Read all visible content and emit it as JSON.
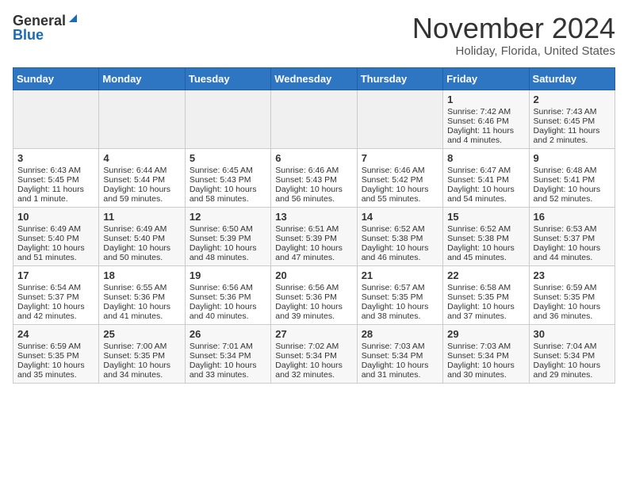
{
  "header": {
    "logo_general": "General",
    "logo_blue": "Blue",
    "month": "November 2024",
    "location": "Holiday, Florida, United States"
  },
  "weekdays": [
    "Sunday",
    "Monday",
    "Tuesday",
    "Wednesday",
    "Thursday",
    "Friday",
    "Saturday"
  ],
  "weeks": [
    [
      {
        "day": "",
        "info": ""
      },
      {
        "day": "",
        "info": ""
      },
      {
        "day": "",
        "info": ""
      },
      {
        "day": "",
        "info": ""
      },
      {
        "day": "",
        "info": ""
      },
      {
        "day": "1",
        "info": "Sunrise: 7:42 AM\nSunset: 6:46 PM\nDaylight: 11 hours\nand 4 minutes."
      },
      {
        "day": "2",
        "info": "Sunrise: 7:43 AM\nSunset: 6:45 PM\nDaylight: 11 hours\nand 2 minutes."
      }
    ],
    [
      {
        "day": "3",
        "info": "Sunrise: 6:43 AM\nSunset: 5:45 PM\nDaylight: 11 hours\nand 1 minute."
      },
      {
        "day": "4",
        "info": "Sunrise: 6:44 AM\nSunset: 5:44 PM\nDaylight: 10 hours\nand 59 minutes."
      },
      {
        "day": "5",
        "info": "Sunrise: 6:45 AM\nSunset: 5:43 PM\nDaylight: 10 hours\nand 58 minutes."
      },
      {
        "day": "6",
        "info": "Sunrise: 6:46 AM\nSunset: 5:43 PM\nDaylight: 10 hours\nand 56 minutes."
      },
      {
        "day": "7",
        "info": "Sunrise: 6:46 AM\nSunset: 5:42 PM\nDaylight: 10 hours\nand 55 minutes."
      },
      {
        "day": "8",
        "info": "Sunrise: 6:47 AM\nSunset: 5:41 PM\nDaylight: 10 hours\nand 54 minutes."
      },
      {
        "day": "9",
        "info": "Sunrise: 6:48 AM\nSunset: 5:41 PM\nDaylight: 10 hours\nand 52 minutes."
      }
    ],
    [
      {
        "day": "10",
        "info": "Sunrise: 6:49 AM\nSunset: 5:40 PM\nDaylight: 10 hours\nand 51 minutes."
      },
      {
        "day": "11",
        "info": "Sunrise: 6:49 AM\nSunset: 5:40 PM\nDaylight: 10 hours\nand 50 minutes."
      },
      {
        "day": "12",
        "info": "Sunrise: 6:50 AM\nSunset: 5:39 PM\nDaylight: 10 hours\nand 48 minutes."
      },
      {
        "day": "13",
        "info": "Sunrise: 6:51 AM\nSunset: 5:39 PM\nDaylight: 10 hours\nand 47 minutes."
      },
      {
        "day": "14",
        "info": "Sunrise: 6:52 AM\nSunset: 5:38 PM\nDaylight: 10 hours\nand 46 minutes."
      },
      {
        "day": "15",
        "info": "Sunrise: 6:52 AM\nSunset: 5:38 PM\nDaylight: 10 hours\nand 45 minutes."
      },
      {
        "day": "16",
        "info": "Sunrise: 6:53 AM\nSunset: 5:37 PM\nDaylight: 10 hours\nand 44 minutes."
      }
    ],
    [
      {
        "day": "17",
        "info": "Sunrise: 6:54 AM\nSunset: 5:37 PM\nDaylight: 10 hours\nand 42 minutes."
      },
      {
        "day": "18",
        "info": "Sunrise: 6:55 AM\nSunset: 5:36 PM\nDaylight: 10 hours\nand 41 minutes."
      },
      {
        "day": "19",
        "info": "Sunrise: 6:56 AM\nSunset: 5:36 PM\nDaylight: 10 hours\nand 40 minutes."
      },
      {
        "day": "20",
        "info": "Sunrise: 6:56 AM\nSunset: 5:36 PM\nDaylight: 10 hours\nand 39 minutes."
      },
      {
        "day": "21",
        "info": "Sunrise: 6:57 AM\nSunset: 5:35 PM\nDaylight: 10 hours\nand 38 minutes."
      },
      {
        "day": "22",
        "info": "Sunrise: 6:58 AM\nSunset: 5:35 PM\nDaylight: 10 hours\nand 37 minutes."
      },
      {
        "day": "23",
        "info": "Sunrise: 6:59 AM\nSunset: 5:35 PM\nDaylight: 10 hours\nand 36 minutes."
      }
    ],
    [
      {
        "day": "24",
        "info": "Sunrise: 6:59 AM\nSunset: 5:35 PM\nDaylight: 10 hours\nand 35 minutes."
      },
      {
        "day": "25",
        "info": "Sunrise: 7:00 AM\nSunset: 5:35 PM\nDaylight: 10 hours\nand 34 minutes."
      },
      {
        "day": "26",
        "info": "Sunrise: 7:01 AM\nSunset: 5:34 PM\nDaylight: 10 hours\nand 33 minutes."
      },
      {
        "day": "27",
        "info": "Sunrise: 7:02 AM\nSunset: 5:34 PM\nDaylight: 10 hours\nand 32 minutes."
      },
      {
        "day": "28",
        "info": "Sunrise: 7:03 AM\nSunset: 5:34 PM\nDaylight: 10 hours\nand 31 minutes."
      },
      {
        "day": "29",
        "info": "Sunrise: 7:03 AM\nSunset: 5:34 PM\nDaylight: 10 hours\nand 30 minutes."
      },
      {
        "day": "30",
        "info": "Sunrise: 7:04 AM\nSunset: 5:34 PM\nDaylight: 10 hours\nand 29 minutes."
      }
    ]
  ]
}
